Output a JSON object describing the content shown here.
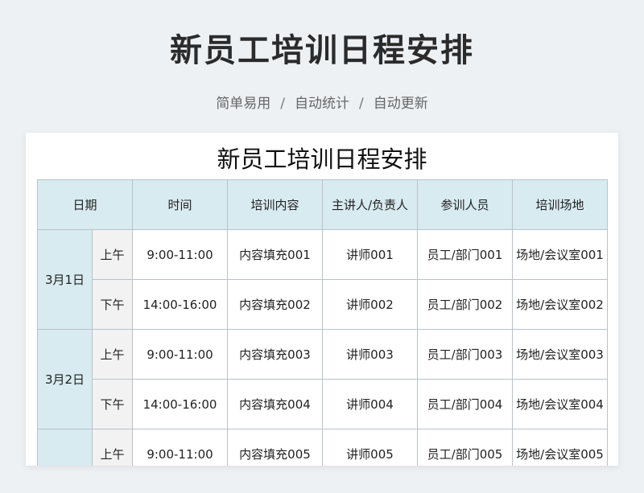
{
  "header": {
    "title": "新员工培训日程安排",
    "tags": [
      "简单易用",
      "自动统计",
      "自动更新"
    ],
    "separator": "/"
  },
  "sheet": {
    "title": "新员工培训日程安排",
    "columns": [
      "日期",
      "时间",
      "培训内容",
      "主讲人/负责人",
      "参训人员",
      "培训场地"
    ],
    "days": [
      {
        "date": "3月1日",
        "sessions": [
          {
            "period": "上午",
            "time": "9:00-11:00",
            "content": "内容填充001",
            "lecturer": "讲师001",
            "attendees": "员工/部门001",
            "venue": "场地/会议室001"
          },
          {
            "period": "下午",
            "time": "14:00-16:00",
            "content": "内容填充002",
            "lecturer": "讲师002",
            "attendees": "员工/部门002",
            "venue": "场地/会议室002"
          }
        ]
      },
      {
        "date": "3月2日",
        "sessions": [
          {
            "period": "上午",
            "time": "9:00-11:00",
            "content": "内容填充003",
            "lecturer": "讲师003",
            "attendees": "员工/部门003",
            "venue": "场地/会议室003"
          },
          {
            "period": "下午",
            "time": "14:00-16:00",
            "content": "内容填充004",
            "lecturer": "讲师004",
            "attendees": "员工/部门004",
            "venue": "场地/会议室004"
          }
        ]
      },
      {
        "date": "",
        "sessions": [
          {
            "period": "上午",
            "time": "9:00-11:00",
            "content": "内容填充005",
            "lecturer": "讲师005",
            "attendees": "员工/部门005",
            "venue": "场地/会议室005"
          }
        ]
      }
    ]
  }
}
